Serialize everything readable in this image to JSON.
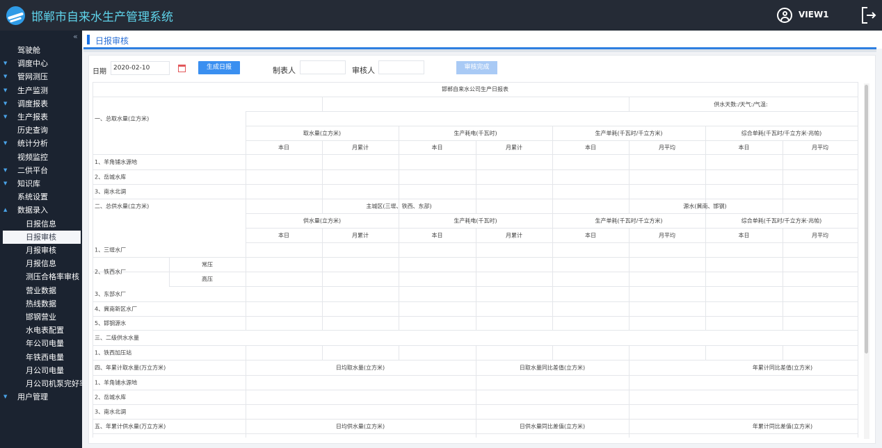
{
  "header": {
    "app_title": "邯郸市自来水生产管理系统",
    "user_name": "VIEW1"
  },
  "sidebar": {
    "collapse": "«",
    "items": [
      {
        "label": "驾驶舱",
        "arrow": "",
        "sub": false
      },
      {
        "label": "调度中心",
        "arrow": "▼",
        "sub": false
      },
      {
        "label": "管网测压",
        "arrow": "▼",
        "sub": false
      },
      {
        "label": "生产监测",
        "arrow": "▼",
        "sub": false
      },
      {
        "label": "调度报表",
        "arrow": "▼",
        "sub": false
      },
      {
        "label": "生产报表",
        "arrow": "▼",
        "sub": false
      },
      {
        "label": "历史查询",
        "arrow": "",
        "sub": false
      },
      {
        "label": "统计分析",
        "arrow": "▼",
        "sub": false
      },
      {
        "label": "视频监控",
        "arrow": "",
        "sub": false
      },
      {
        "label": "二供平台",
        "arrow": "▼",
        "sub": false
      },
      {
        "label": "知识库",
        "arrow": "▼",
        "sub": false
      },
      {
        "label": "系统设置",
        "arrow": "",
        "sub": false
      },
      {
        "label": "数据录入",
        "arrow": "▲",
        "sub": false
      },
      {
        "label": "日报信息",
        "arrow": "",
        "sub": true
      },
      {
        "label": "日报审核",
        "arrow": "",
        "sub": true,
        "active": true
      },
      {
        "label": "月报审核",
        "arrow": "",
        "sub": true
      },
      {
        "label": "月报信息",
        "arrow": "",
        "sub": true
      },
      {
        "label": "测压合格率审核",
        "arrow": "",
        "sub": true
      },
      {
        "label": "营业数据",
        "arrow": "",
        "sub": true
      },
      {
        "label": "热线数据",
        "arrow": "",
        "sub": true
      },
      {
        "label": "邯钢营业",
        "arrow": "",
        "sub": true
      },
      {
        "label": "水电表配置",
        "arrow": "",
        "sub": true
      },
      {
        "label": "年公司电量",
        "arrow": "",
        "sub": true
      },
      {
        "label": "年铁西电量",
        "arrow": "",
        "sub": true
      },
      {
        "label": "月公司电量",
        "arrow": "",
        "sub": true
      },
      {
        "label": "月公司机泵完好率",
        "arrow": "",
        "sub": true
      },
      {
        "label": "用户管理",
        "arrow": "▼",
        "sub": false
      }
    ]
  },
  "page": {
    "tab_title": "日报审核"
  },
  "toolbar": {
    "date_label": "日期",
    "date_value": "2020-02-10",
    "generate_label": "生成日报",
    "maker_label": "制表人",
    "reviewer_label": "审核人",
    "done_label": "审核完成"
  },
  "report": {
    "title": "邯郸自来水公司生产日报表",
    "weather": "供水天数:/天气:/气温:",
    "row_headers": [
      "一、总取水量(立方米)",
      "1、羊角铺水源地",
      "2、岳城水库",
      "3、南水北调",
      "二、总供水量(立方米)",
      "1、三堤水厂",
      "2、铁西水厂",
      "3、东部水厂",
      "4、冀南新区水厂",
      "5、邯钢源水",
      "三、二级供水水量",
      "1、铁西加压站",
      "四、年累计取水量(万立方米)",
      "1、羊角铺水源地",
      "2、岳城水库",
      "3、南水北调",
      "五、年累计供水量(万立方米)"
    ],
    "pressure": [
      "常压",
      "高压"
    ],
    "intake_groups": [
      "取水量(立方米)",
      "生产耗电(千瓦时)",
      "生产单耗(千瓦时/千立方米)",
      "综合单耗(千瓦时/千立方米·兆帕)"
    ],
    "supply_groups": [
      "供水量(立方米)",
      "生产耗电(千瓦时)",
      "生产单耗(千瓦时/千立方米)",
      "综合单耗(千瓦时/千立方米·兆帕)"
    ],
    "sub_headers": [
      "本日",
      "月累计",
      "本日",
      "月累计",
      "本日",
      "月平均",
      "本日",
      "月平均"
    ],
    "supply_regions": [
      "主城区(三堤、铁西、东部)",
      "源水(冀南、邯钢)"
    ],
    "annual_intake_headers": [
      "日均取水量(立方米)",
      "日取水量同比差值(立方米)",
      "年累计同比差值(立方米)"
    ],
    "annual_supply_headers": [
      "日均供水量(立方米)",
      "日供水量同比差值(立方米)",
      "年累计同比差值(立方米)"
    ]
  }
}
